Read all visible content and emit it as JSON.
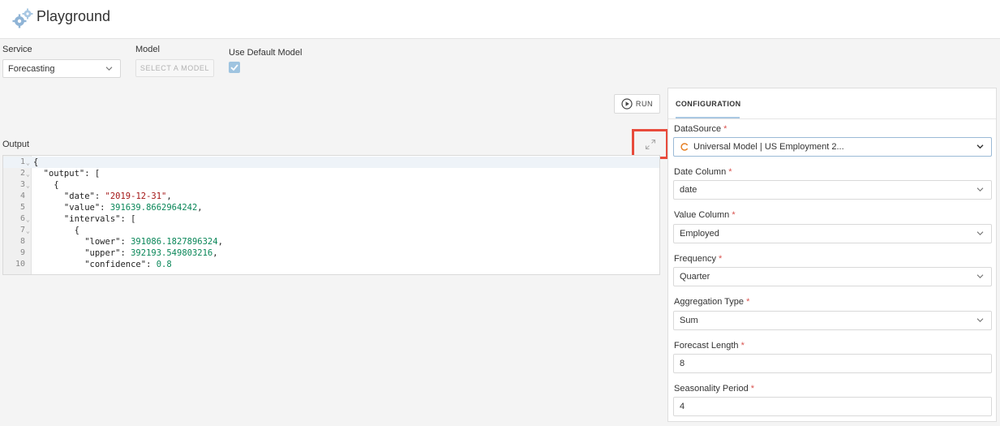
{
  "header": {
    "title": "Playground",
    "logo_icon": "gears-icon"
  },
  "controls": {
    "service_label": "Service",
    "service_value": "Forecasting",
    "model_label": "Model",
    "model_button": "SELECT A MODEL",
    "default_model_label": "Use Default Model",
    "default_model_checked": true,
    "run_label": "RUN"
  },
  "output": {
    "label": "Output",
    "lines": [
      {
        "n": "1",
        "fold": true
      },
      {
        "n": "2",
        "fold": true
      },
      {
        "n": "3",
        "fold": true
      },
      {
        "n": "4",
        "fold": false
      },
      {
        "n": "5",
        "fold": false
      },
      {
        "n": "6",
        "fold": true
      },
      {
        "n": "7",
        "fold": true
      },
      {
        "n": "8",
        "fold": false
      },
      {
        "n": "9",
        "fold": false
      },
      {
        "n": "10",
        "fold": false
      }
    ],
    "code": {
      "l1": "{",
      "l2": "  \"output\": [",
      "l3": "    {",
      "l4_key": "      \"date\": ",
      "l4_val": "\"2019-12-31\"",
      "l4_end": ",",
      "l5_key": "      \"value\": ",
      "l5_val": "391639.8662964242",
      "l5_end": ",",
      "l6": "      \"intervals\": [",
      "l7": "        {",
      "l8_key": "          \"lower\": ",
      "l8_val": "391086.1827896324",
      "l8_end": ",",
      "l9_key": "          \"upper\": ",
      "l9_val": "392193.549803216",
      "l9_end": ",",
      "l10_key": "          \"confidence\": ",
      "l10_val": "0.8"
    }
  },
  "config": {
    "tab": "CONFIGURATION",
    "required_mark": "*",
    "fields": {
      "datasource_label": "DataSource",
      "datasource_value": "Universal Model | US Employment 2...",
      "date_column_label": "Date Column",
      "date_column_value": "date",
      "value_column_label": "Value Column",
      "value_column_value": "Employed",
      "frequency_label": "Frequency",
      "frequency_value": "Quarter",
      "aggregation_label": "Aggregation Type",
      "aggregation_value": "Sum",
      "forecast_length_label": "Forecast Length",
      "forecast_length_value": "8",
      "seasonality_label": "Seasonality Period",
      "seasonality_value": "4"
    }
  },
  "colors": {
    "highlight_box": "#e84b3c",
    "checkbox": "#9fc4e0",
    "required": "#d9534f"
  }
}
